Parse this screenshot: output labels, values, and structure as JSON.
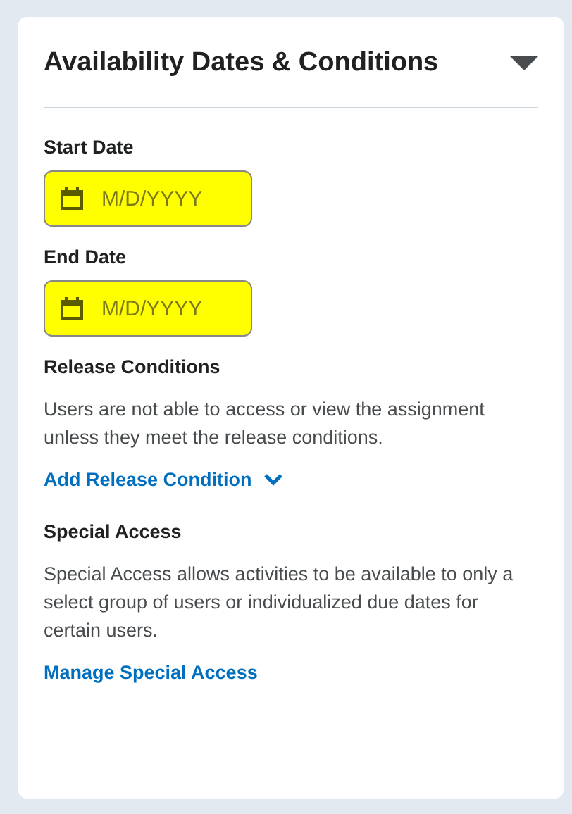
{
  "panel": {
    "title": "Availability Dates & Conditions",
    "expanded": true
  },
  "date_fields": [
    {
      "label": "Start Date",
      "placeholder": "M/D/YYYY",
      "highlighted": true
    },
    {
      "label": "End Date",
      "placeholder": "M/D/YYYY",
      "highlighted": true
    }
  ],
  "sections": [
    {
      "heading": "Release Conditions",
      "text": "Users are not able to access or view the assignment unless they meet the release conditions.",
      "link": "Add Release Condition",
      "link_has_menu": true
    },
    {
      "heading": "Special Access",
      "text": "Special Access allows activities to be available to only a select group of users or individualized due dates for certain users.",
      "link": "Manage Special Access",
      "link_has_menu": false
    }
  ]
}
